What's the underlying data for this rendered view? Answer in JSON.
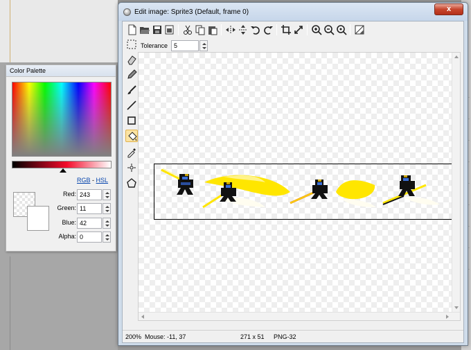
{
  "window": {
    "title": "Edit image: Sprite3 (Default, frame 0)",
    "close_label": "x"
  },
  "toolbar": {
    "buttons": [
      "new-icon",
      "open-icon",
      "save-icon",
      "save-as-icon",
      "cut-icon",
      "copy-icon",
      "paste-icon",
      "flip-horizontal-icon",
      "flip-vertical-icon",
      "rotate-left-icon",
      "rotate-right-icon",
      "crop-icon",
      "resize-icon",
      "zoom-in-icon",
      "zoom-out-icon",
      "zoom-reset-icon",
      "grid-icon"
    ]
  },
  "options": {
    "tolerance_label": "Tolerance",
    "tolerance_value": "5"
  },
  "tools": [
    "select-rect-icon",
    "eraser-icon",
    "pencil-icon",
    "brush-icon",
    "line-icon",
    "rectangle-icon",
    "fill-bucket-icon",
    "eyedropper-icon",
    "spray-icon",
    "shape-icon"
  ],
  "active_tool": "fill-bucket-icon",
  "status": {
    "zoom": "200%",
    "mouse": "Mouse: -11, 37",
    "size": "271 x 51",
    "format": "PNG-32"
  },
  "palette": {
    "title": "Color Palette",
    "rgb_link": "RGB",
    "separator": "-",
    "hsl_link": "HSL",
    "red_label": "Red:",
    "red_value": "243",
    "green_label": "Green:",
    "green_value": "11",
    "blue_label": "Blue:",
    "blue_value": "42",
    "alpha_label": "Alpha:",
    "alpha_value": "0"
  },
  "colors": {
    "accent": "#f30b2a",
    "sprite_yellow": "#ffe600",
    "active_tool_bg": "#fbe3a3"
  }
}
